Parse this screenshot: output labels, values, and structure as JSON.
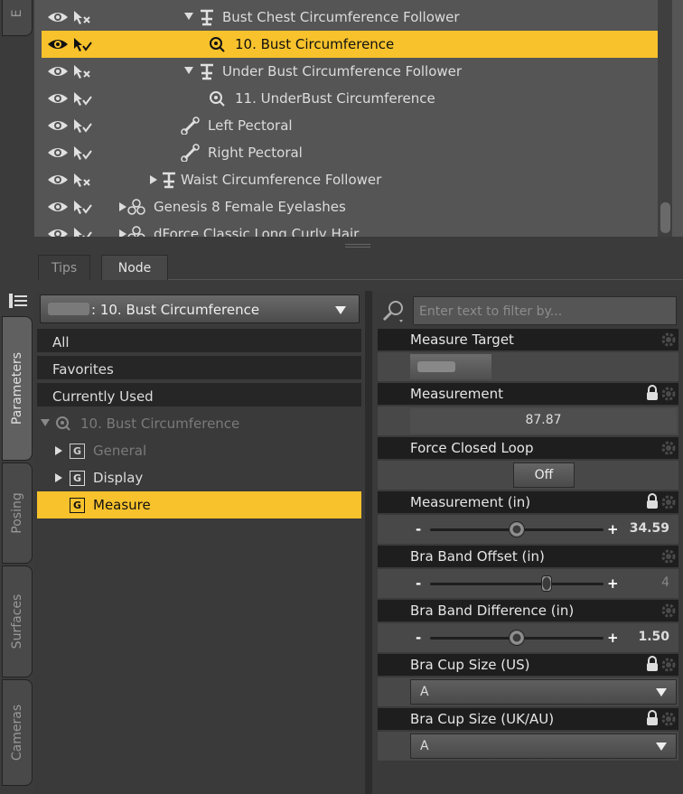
{
  "left_tabs": [
    {
      "label": "E"
    },
    {
      "label": "Parameters"
    },
    {
      "label": "Posing"
    },
    {
      "label": "Surfaces"
    },
    {
      "label": "Cameras"
    }
  ],
  "scene": {
    "rows": [
      {
        "label": "Bust Chest Circumference Follower",
        "icon": "follower-icon",
        "expander": "down",
        "selectable": false,
        "selected": false
      },
      {
        "label": "10. Bust Circumference",
        "icon": "measure-icon",
        "expander": "none",
        "selectable": true,
        "selected": true
      },
      {
        "label": "Under Bust Circumference Follower",
        "icon": "follower-icon",
        "expander": "down",
        "selectable": false,
        "selected": false
      },
      {
        "label": "11. UnderBust Circumference",
        "icon": "measure-icon",
        "expander": "none",
        "selectable": true,
        "selected": false
      },
      {
        "label": "Left Pectoral",
        "icon": "bone-icon",
        "expander": "none",
        "selectable": true,
        "selected": false
      },
      {
        "label": "Right Pectoral",
        "icon": "bone-icon",
        "expander": "none",
        "selectable": true,
        "selected": false
      },
      {
        "label": "Waist Circumference Follower",
        "icon": "follower-icon",
        "expander": "right",
        "selectable": false,
        "selected": false
      },
      {
        "label": "Genesis 8 Female Eyelashes",
        "icon": "figure-icon",
        "expander": "right",
        "selectable": true,
        "selected": false
      },
      {
        "label": "dForce Classic Long Curly Hair",
        "icon": "figure-icon",
        "expander": "right",
        "selectable": true,
        "selected": false
      }
    ]
  },
  "bottom_tabs": [
    {
      "label": "Tips",
      "active": false
    },
    {
      "label": "Node",
      "active": true
    }
  ],
  "node_selector": {
    "value": ": 10. Bust Circumference"
  },
  "groups": {
    "all": "All",
    "favorites": "Favorites",
    "current": "Currently Used"
  },
  "tree": {
    "root": "10. Bust Circumference",
    "items": [
      {
        "label": "General"
      },
      {
        "label": "Display"
      },
      {
        "label": "Measure"
      }
    ]
  },
  "filter": {
    "placeholder": "Enter text to filter by..."
  },
  "params": {
    "measure_target": {
      "label": "Measure Target"
    },
    "measurement": {
      "label": "Measurement",
      "value": "87.87"
    },
    "force_closed_loop": {
      "label": "Force Closed Loop",
      "value": "Off"
    },
    "measurement_in": {
      "label": "Measurement (in)",
      "value": "34.59",
      "minus": "-",
      "plus": "+",
      "level": 0.5
    },
    "bra_band_offset": {
      "label": "Bra Band Offset (in)",
      "value": "4",
      "minus": "-",
      "plus": "+",
      "level": 0.67
    },
    "bra_band_diff": {
      "label": "Bra Band Difference (in)",
      "value": "1.50",
      "minus": "-",
      "plus": "+",
      "level": 0.5
    },
    "cup_us": {
      "label": "Bra Cup Size (US)",
      "value": "A"
    },
    "cup_uk": {
      "label": "Bra Cup Size (UK/AU)",
      "value": "A"
    }
  },
  "colors": {
    "selection": "#f7c22c",
    "panel": "#3a3a3a",
    "header": "#1e1e1e"
  }
}
